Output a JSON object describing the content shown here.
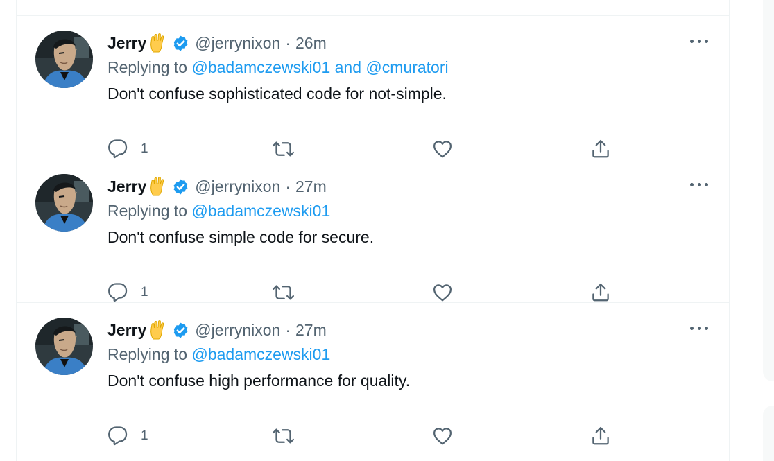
{
  "colors": {
    "accent": "#1d9bf0",
    "secondary_text": "#536471",
    "primary_text": "#0f1419",
    "divider": "#eff3f4"
  },
  "tweets": [
    {
      "author": {
        "name": "Jerry",
        "emoji": "vulcan-salute-emoji",
        "verified": true,
        "handle": "@jerrynixon"
      },
      "separator": "·",
      "time": "26m",
      "replying_prefix": "Replying to ",
      "mentions": [
        "@badamczewski01",
        "@cmuratori"
      ],
      "mention_joiner": " and ",
      "text": "Don't confuse sophisticated code for not-simple.",
      "reply_count": "1"
    },
    {
      "author": {
        "name": "Jerry",
        "emoji": "vulcan-salute-emoji",
        "verified": true,
        "handle": "@jerrynixon"
      },
      "separator": "·",
      "time": "27m",
      "replying_prefix": "Replying to ",
      "mentions": [
        "@badamczewski01"
      ],
      "text": "Don't confuse simple code for secure.",
      "reply_count": "1"
    },
    {
      "author": {
        "name": "Jerry",
        "emoji": "vulcan-salute-emoji",
        "verified": true,
        "handle": "@jerrynixon"
      },
      "separator": "·",
      "time": "27m",
      "replying_prefix": "Replying to ",
      "mentions": [
        "@badamczewski01"
      ],
      "text": "Don't confuse high performance for quality.",
      "reply_count": "1"
    }
  ]
}
